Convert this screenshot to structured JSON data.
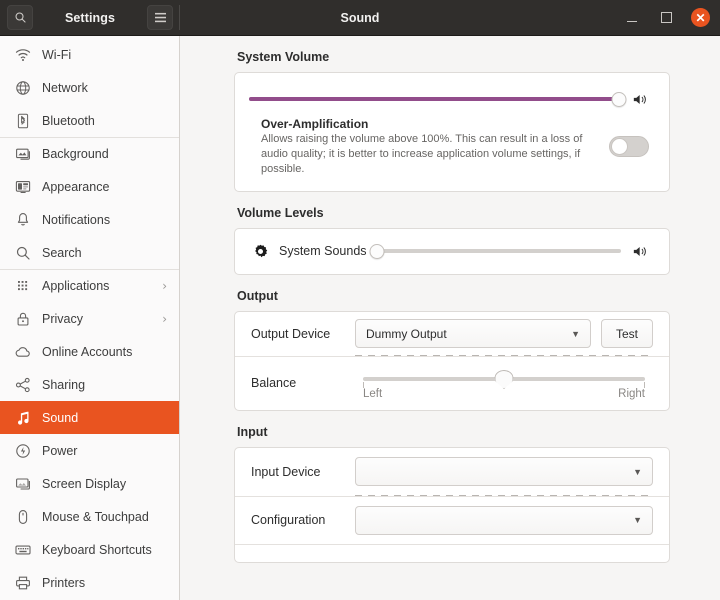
{
  "titlebar": {
    "search_icon": "search-icon",
    "panel_title": "Settings",
    "menu_icon": "hamburger-menu-icon",
    "window_title": "Sound",
    "minimize_label": "",
    "maximize_label": "",
    "close_label": "✕"
  },
  "sidebar": {
    "items": [
      {
        "label": "Wi-Fi",
        "icon": "wifi-icon",
        "chevron": "",
        "active": false,
        "separator_above": false
      },
      {
        "label": "Network",
        "icon": "network-globe-icon",
        "chevron": "",
        "active": false,
        "separator_above": false
      },
      {
        "label": "Bluetooth",
        "icon": "bluetooth-icon",
        "chevron": "",
        "active": false,
        "separator_above": false
      },
      {
        "label": "Background",
        "icon": "background-monitor-icon",
        "chevron": "",
        "active": false,
        "separator_above": true
      },
      {
        "label": "Appearance",
        "icon": "appearance-icon",
        "chevron": "",
        "active": false,
        "separator_above": false
      },
      {
        "label": "Notifications",
        "icon": "bell-icon",
        "chevron": "",
        "active": false,
        "separator_above": false
      },
      {
        "label": "Search",
        "icon": "search-icon",
        "chevron": "",
        "active": false,
        "separator_above": false
      },
      {
        "label": "Applications",
        "icon": "apps-grid-icon",
        "chevron": "›",
        "active": false,
        "separator_above": true
      },
      {
        "label": "Privacy",
        "icon": "lock-icon",
        "chevron": "›",
        "active": false,
        "separator_above": false
      },
      {
        "label": "Online Accounts",
        "icon": "cloud-icon",
        "chevron": "",
        "active": false,
        "separator_above": false
      },
      {
        "label": "Sharing",
        "icon": "share-nodes-icon",
        "chevron": "",
        "active": false,
        "separator_above": false
      },
      {
        "label": "Sound",
        "icon": "music-note-icon",
        "chevron": "",
        "active": true,
        "separator_above": false
      },
      {
        "label": "Power",
        "icon": "power-icon",
        "chevron": "",
        "active": false,
        "separator_above": false
      },
      {
        "label": "Screen Display",
        "icon": "display-icon",
        "chevron": "",
        "active": false,
        "separator_above": false
      },
      {
        "label": "Mouse & Touchpad",
        "icon": "mouse-icon",
        "chevron": "",
        "active": false,
        "separator_above": false
      },
      {
        "label": "Keyboard Shortcuts",
        "icon": "keyboard-icon",
        "chevron": "",
        "active": false,
        "separator_above": false
      },
      {
        "label": "Printers",
        "icon": "printer-icon",
        "chevron": "",
        "active": false,
        "separator_above": false
      }
    ]
  },
  "main": {
    "system_volume": {
      "title": "System Volume",
      "slider_value": 100,
      "slider_fill_color": "#924d8b",
      "speaker_icon": "speaker-volume-icon",
      "over_amplification": {
        "title": "Over-Amplification",
        "description": "Allows raising the volume above 100%. This can result in a loss of audio quality; it is better to increase application volume settings, if possible.",
        "toggle_state": "off"
      }
    },
    "volume_levels": {
      "title": "Volume Levels",
      "rows": [
        {
          "icon": "gear-icon",
          "label": "System Sounds",
          "slider_value": 0,
          "speaker_icon": "speaker-volume-icon"
        }
      ]
    },
    "output": {
      "title": "Output",
      "device_label": "Output Device",
      "device_value": "Dummy Output",
      "test_button": "Test",
      "balance_label": "Balance",
      "balance_value": 50,
      "balance_left": "Left",
      "balance_right": "Right"
    },
    "input": {
      "title": "Input",
      "device_label": "Input Device",
      "device_value": "",
      "configuration_label": "Configuration",
      "configuration_value": ""
    }
  },
  "colors": {
    "accent": "#e95420",
    "titlebar_bg": "#302e2c",
    "slider_fill": "#924d8b",
    "window_bg": "#f6f5f4"
  }
}
